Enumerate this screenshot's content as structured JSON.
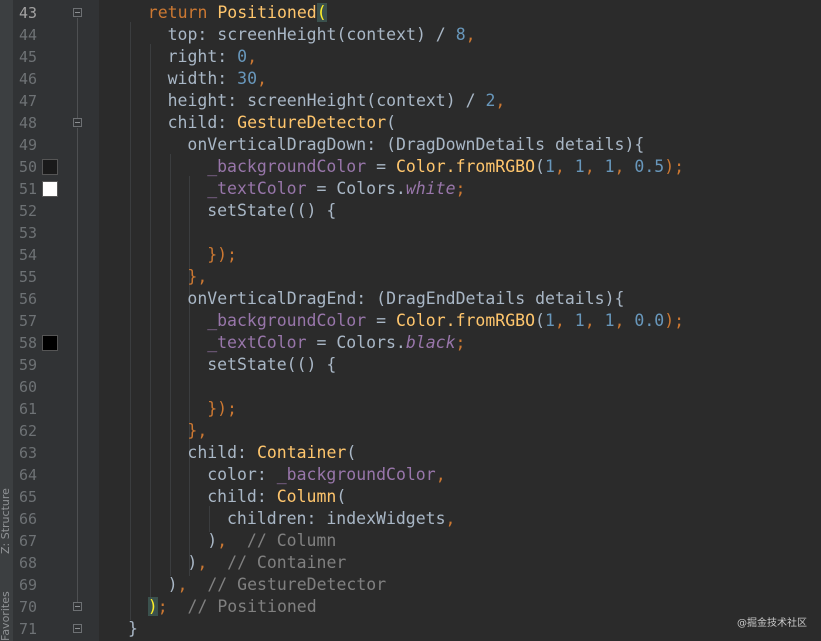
{
  "side_tabs": {
    "structure": "Z: Structure",
    "favorites": "Favorites"
  },
  "gutter": {
    "line_numbers": [
      "43",
      "44",
      "45",
      "46",
      "47",
      "48",
      "49",
      "50",
      "51",
      "52",
      "53",
      "54",
      "55",
      "56",
      "57",
      "58",
      "59",
      "60",
      "61",
      "62",
      "63",
      "64",
      "65",
      "66",
      "67",
      "68",
      "69",
      "70",
      "71"
    ],
    "current_line": "43",
    "color_swatches": [
      {
        "line": "50",
        "color": "#1a1a1a"
      },
      {
        "line": "51",
        "color": "#ffffff"
      },
      {
        "line": "58",
        "color": "#000000"
      }
    ]
  },
  "code": {
    "lines": [
      {
        "indent": 1,
        "tokens": [
          {
            "t": "return ",
            "c": "kw"
          },
          {
            "t": "Positioned",
            "c": "fn"
          },
          {
            "t": "(",
            "c": "brace"
          }
        ]
      },
      {
        "indent": 2,
        "tokens": [
          {
            "t": "top: screenHeight(context) / "
          },
          {
            "t": "8",
            "c": "num"
          },
          {
            "t": ",",
            "c": "kw"
          }
        ]
      },
      {
        "indent": 2,
        "tokens": [
          {
            "t": "right: "
          },
          {
            "t": "0",
            "c": "num"
          },
          {
            "t": ",",
            "c": "kw"
          }
        ]
      },
      {
        "indent": 2,
        "tokens": [
          {
            "t": "width: "
          },
          {
            "t": "30",
            "c": "num"
          },
          {
            "t": ",",
            "c": "kw"
          }
        ]
      },
      {
        "indent": 2,
        "tokens": [
          {
            "t": "height: screenHeight(context) / "
          },
          {
            "t": "2",
            "c": "num"
          },
          {
            "t": ",",
            "c": "kw"
          }
        ]
      },
      {
        "indent": 2,
        "tokens": [
          {
            "t": "child: "
          },
          {
            "t": "GestureDetector",
            "c": "fn"
          },
          {
            "t": "("
          }
        ]
      },
      {
        "indent": 3,
        "tokens": [
          {
            "t": "onVerticalDragDown: (DragDownDetails details){"
          }
        ]
      },
      {
        "indent": 4,
        "tokens": [
          {
            "t": "_backgroundColor",
            "c": "var"
          },
          {
            "t": " = "
          },
          {
            "t": "Color.",
            "c": "fn"
          },
          {
            "t": "fromRGBO",
            "c": "fn"
          },
          {
            "t": "("
          },
          {
            "t": "1",
            "c": "num"
          },
          {
            "t": ", ",
            "c": "kw"
          },
          {
            "t": "1",
            "c": "num"
          },
          {
            "t": ", ",
            "c": "kw"
          },
          {
            "t": "1",
            "c": "num"
          },
          {
            "t": ", ",
            "c": "kw"
          },
          {
            "t": "0.5",
            "c": "num"
          },
          {
            "t": ");",
            "c": "kw"
          }
        ]
      },
      {
        "indent": 4,
        "tokens": [
          {
            "t": "_textColor",
            "c": "var"
          },
          {
            "t": " = Colors."
          },
          {
            "t": "white",
            "c": "ital"
          },
          {
            "t": ";",
            "c": "kw"
          }
        ]
      },
      {
        "indent": 4,
        "tokens": [
          {
            "t": "setState(() {"
          }
        ]
      },
      {
        "indent": 4,
        "tokens": []
      },
      {
        "indent": 4,
        "tokens": [
          {
            "t": "});",
            "c": "kw"
          }
        ]
      },
      {
        "indent": 3,
        "tokens": [
          {
            "t": "},",
            "c": "kw"
          }
        ]
      },
      {
        "indent": 3,
        "tokens": [
          {
            "t": "onVerticalDragEnd: (DragEndDetails details){"
          }
        ]
      },
      {
        "indent": 4,
        "tokens": [
          {
            "t": "_backgroundColor",
            "c": "var"
          },
          {
            "t": " = "
          },
          {
            "t": "Color.",
            "c": "fn"
          },
          {
            "t": "fromRGBO",
            "c": "fn"
          },
          {
            "t": "("
          },
          {
            "t": "1",
            "c": "num"
          },
          {
            "t": ", ",
            "c": "kw"
          },
          {
            "t": "1",
            "c": "num"
          },
          {
            "t": ", ",
            "c": "kw"
          },
          {
            "t": "1",
            "c": "num"
          },
          {
            "t": ", ",
            "c": "kw"
          },
          {
            "t": "0.0",
            "c": "num"
          },
          {
            "t": ");",
            "c": "kw"
          }
        ]
      },
      {
        "indent": 4,
        "tokens": [
          {
            "t": "_textColor",
            "c": "var"
          },
          {
            "t": " = Colors."
          },
          {
            "t": "black",
            "c": "ital"
          },
          {
            "t": ";",
            "c": "kw"
          }
        ]
      },
      {
        "indent": 4,
        "tokens": [
          {
            "t": "setState(() {"
          }
        ]
      },
      {
        "indent": 4,
        "tokens": []
      },
      {
        "indent": 4,
        "tokens": [
          {
            "t": "});",
            "c": "kw"
          }
        ]
      },
      {
        "indent": 3,
        "tokens": [
          {
            "t": "},",
            "c": "kw"
          }
        ]
      },
      {
        "indent": 3,
        "tokens": [
          {
            "t": "child: "
          },
          {
            "t": "Container",
            "c": "fn"
          },
          {
            "t": "("
          }
        ]
      },
      {
        "indent": 4,
        "tokens": [
          {
            "t": "color: "
          },
          {
            "t": "_backgroundColor",
            "c": "var"
          },
          {
            "t": ",",
            "c": "kw"
          }
        ]
      },
      {
        "indent": 4,
        "tokens": [
          {
            "t": "child: "
          },
          {
            "t": "Column",
            "c": "fn"
          },
          {
            "t": "("
          }
        ]
      },
      {
        "indent": 5,
        "tokens": [
          {
            "t": "children: indexWidgets"
          },
          {
            "t": ",",
            "c": "kw"
          }
        ]
      },
      {
        "indent": 4,
        "tokens": [
          {
            "t": ")"
          },
          {
            "t": ",",
            "c": "kw"
          },
          {
            "t": "  // Column",
            "c": "cm"
          }
        ]
      },
      {
        "indent": 3,
        "tokens": [
          {
            "t": ")"
          },
          {
            "t": ",",
            "c": "kw"
          },
          {
            "t": "  // Container",
            "c": "cm"
          }
        ]
      },
      {
        "indent": 2,
        "tokens": [
          {
            "t": ")"
          },
          {
            "t": ",",
            "c": "kw"
          },
          {
            "t": "  // GestureDetector",
            "c": "cm"
          }
        ]
      },
      {
        "indent": 1,
        "tokens": [
          {
            "t": ")",
            "c": "brace"
          },
          {
            "t": ";",
            "c": "kw"
          },
          {
            "t": "  // Positioned",
            "c": "cm"
          }
        ]
      },
      {
        "indent": 0,
        "tokens": [
          {
            "t": "}"
          }
        ]
      }
    ]
  },
  "watermark": "@掘金技术社区"
}
